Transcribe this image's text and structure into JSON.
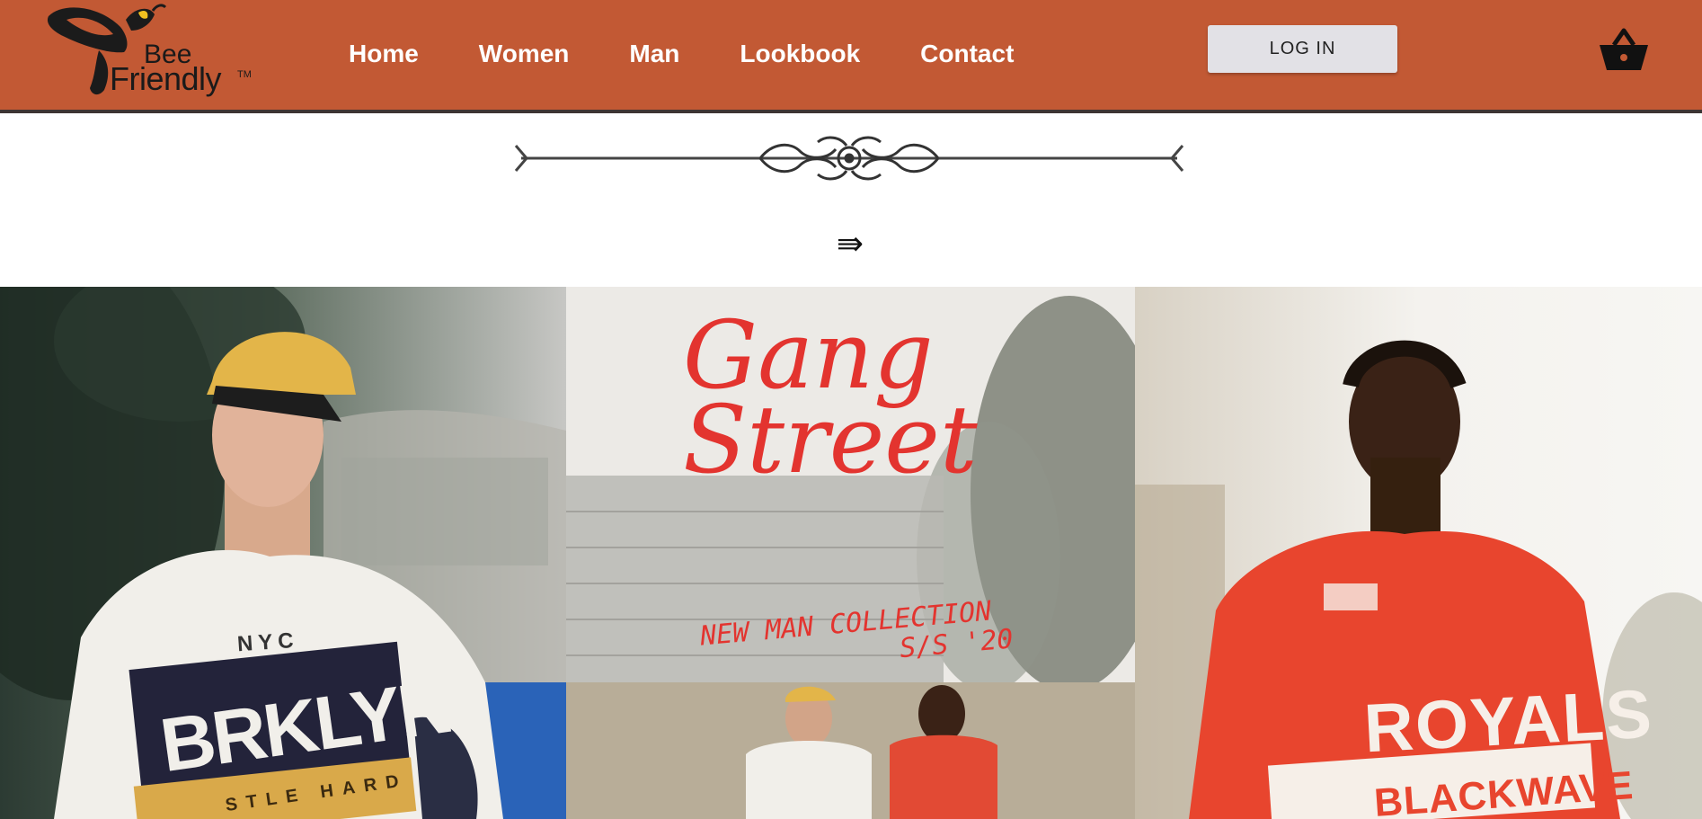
{
  "brand": {
    "line1": "Bee",
    "line2": "Friendly",
    "trademark": "TM"
  },
  "nav": {
    "links": [
      "Home",
      "Women",
      "Man",
      "Lookbook",
      "Contact"
    ]
  },
  "header": {
    "login_label": "LOG IN",
    "cart_icon": "basket-icon"
  },
  "arrow": {
    "glyph": "⇛",
    "icon": "triple-right-arrow-icon"
  },
  "gallery": {
    "panel1": {
      "tshirt_city": "NYC",
      "tshirt_main": "BRKLYN",
      "tshirt_small": "STLE HARD"
    },
    "panel2": {
      "title_line1": "Gang",
      "title_line2": "Street",
      "subtitle": "NEW MAN COLLECTION",
      "season": "S/S '20"
    },
    "panel3": {
      "tshirt_main": "ROYALS",
      "tshirt_bottom": "BLACKWAVE"
    }
  },
  "colors": {
    "nav_bg": "#c25934",
    "accent_red": "#e3342f",
    "text_white": "#ffffff"
  }
}
